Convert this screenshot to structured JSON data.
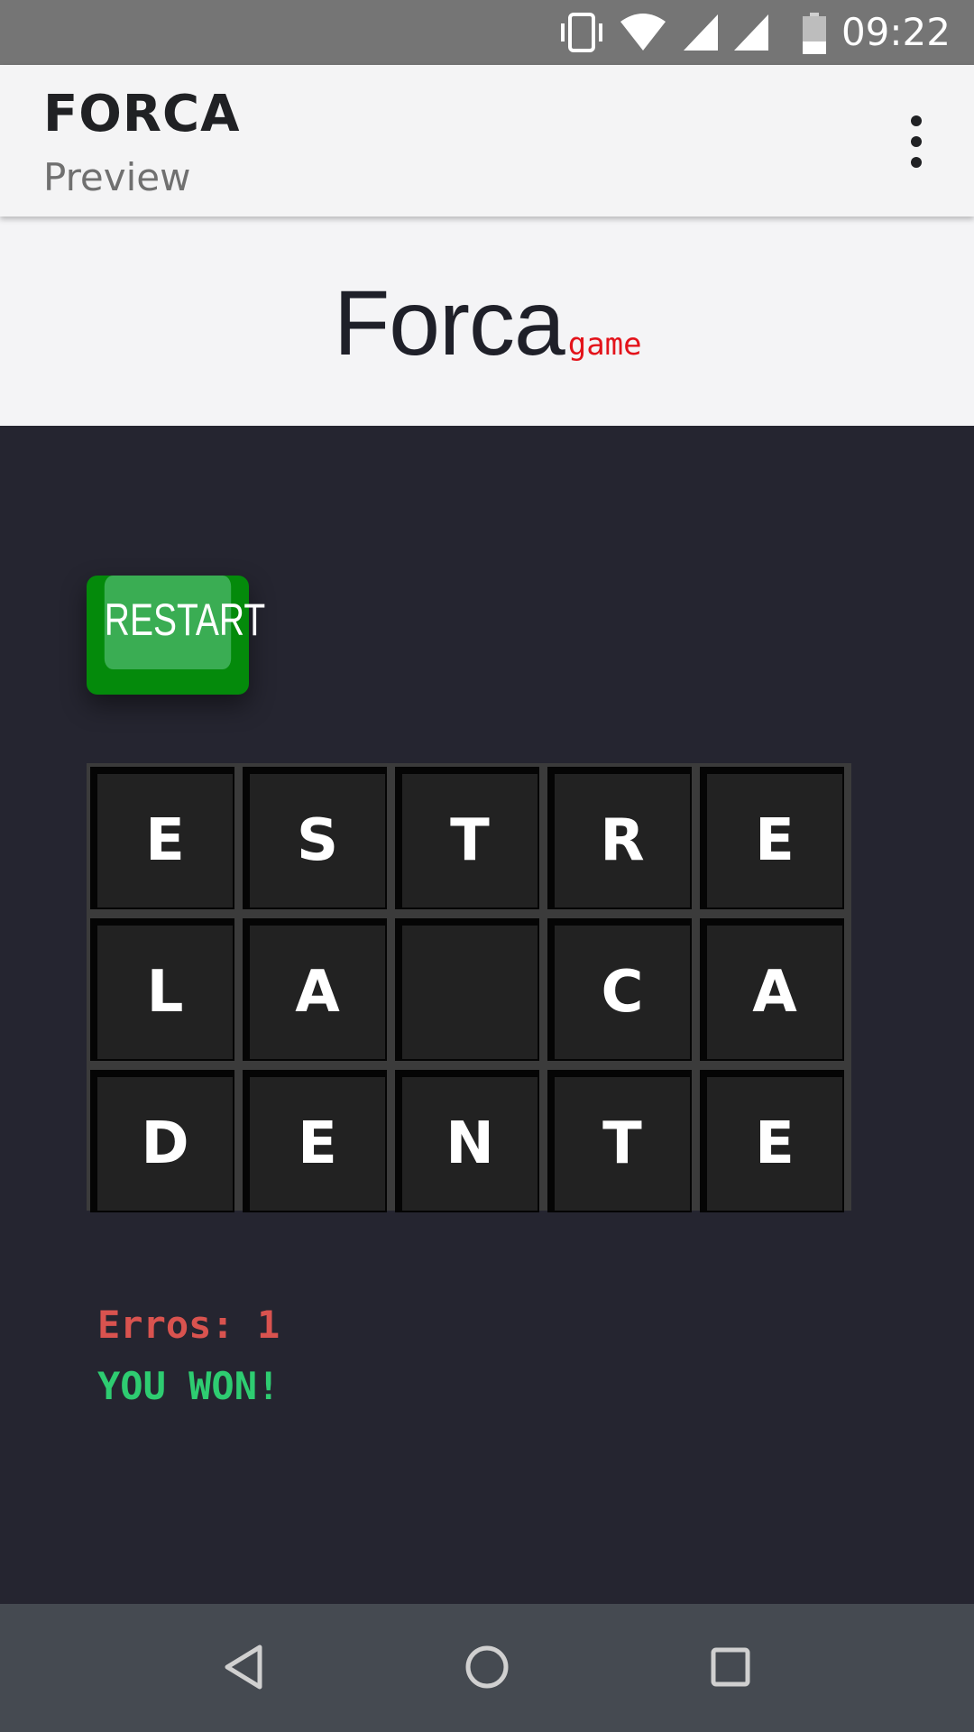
{
  "status_bar": {
    "time": "09:22",
    "icons": [
      "vibrate-icon",
      "wifi-icon",
      "signal-icon",
      "signal-icon",
      "battery-icon"
    ]
  },
  "app_bar": {
    "title": "FORCA",
    "subtitle": "Preview",
    "menu_icon": "more-vert-icon"
  },
  "header": {
    "logo_main": "Forca",
    "logo_suffix": "game"
  },
  "game": {
    "restart_label": "RESTART",
    "board": [
      [
        "E",
        "S",
        "T",
        "R",
        "E"
      ],
      [
        "L",
        "A",
        "",
        "C",
        "A"
      ],
      [
        "D",
        "E",
        "N",
        "T",
        "E"
      ]
    ],
    "errors_text": "Erros: 1",
    "result_text": "YOU WON!"
  },
  "nav_bar": {
    "icons": [
      "back-icon",
      "home-icon",
      "recents-icon"
    ]
  },
  "colors": {
    "game_background": "#252530",
    "restart_green": "#3aad53",
    "errors_red": "#d9534f",
    "won_green": "#2ecc71",
    "logo_suffix_red": "#e3131b"
  }
}
